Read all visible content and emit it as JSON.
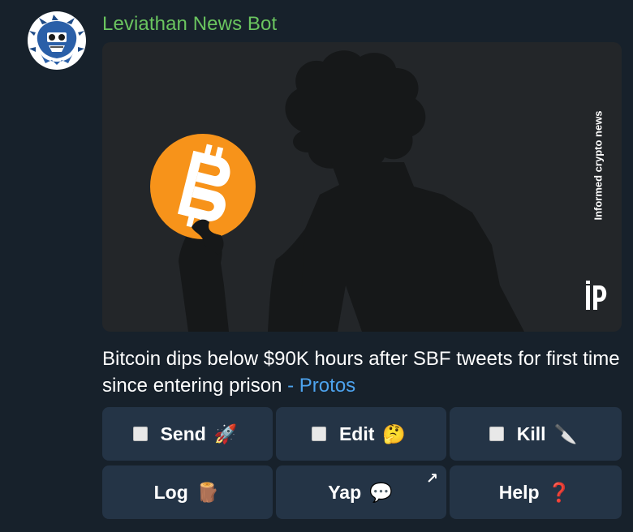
{
  "message": {
    "sender_name": "Leviathan News Bot",
    "avatar_icon": "leviathan-sea-creature-logo",
    "preview": {
      "watermark_vertical": "Informed crypto news",
      "logo_icon": "protos-logo",
      "art": "bitcoin-coin-and-silhouette"
    },
    "caption_text": "Bitcoin dips below $90K hours after SBF tweets for first time since entering prison",
    "caption_link": "- Protos"
  },
  "keyboard": {
    "row1": [
      {
        "label": "Send",
        "icon": "🚀",
        "checkbox": true
      },
      {
        "label": "Edit",
        "icon": "🤔",
        "checkbox": true
      },
      {
        "label": "Kill",
        "icon": "🔪",
        "checkbox": true
      }
    ],
    "row2": [
      {
        "label": "Log",
        "icon": "🪵"
      },
      {
        "label": "Yap",
        "icon": "💬",
        "corner_icon": "↗"
      },
      {
        "label": "Help",
        "icon": "❓"
      }
    ]
  },
  "colors": {
    "background": "#17212b",
    "sender_name": "#6ac45f",
    "link": "#4da3ee",
    "button_bg": "#243446",
    "bitcoin_orange": "#f7931a"
  }
}
